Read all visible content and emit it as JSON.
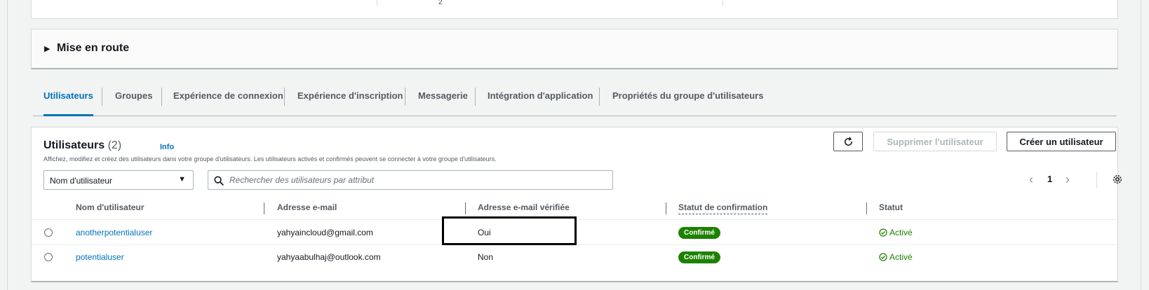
{
  "top_card": {
    "mark": "2"
  },
  "getting_started": {
    "title": "Mise en route"
  },
  "tabs": [
    {
      "label": "Utilisateurs",
      "active": true
    },
    {
      "label": "Groupes"
    },
    {
      "label": "Expérience de connexion"
    },
    {
      "label": "Expérience d'inscription"
    },
    {
      "label": "Messagerie"
    },
    {
      "label": "Intégration d'application"
    },
    {
      "label": "Propriétés du groupe d'utilisateurs"
    }
  ],
  "users_panel": {
    "title": "Utilisateurs",
    "count": "(2)",
    "info": "Info",
    "description": "Affichez, modifiez et créez des utilisateurs dans votre groupe d'utilisateurs. Les utilisateurs activés et confirmés peuvent se connecter à votre groupe d'utilisateurs.",
    "refresh_icon": "refresh-icon",
    "delete_label": "Supprimer l'utilisateur",
    "create_label": "Créer un utilisateur",
    "filter_select": "Nom d'utilisateur",
    "search_placeholder": "Rechercher des utilisateurs par attribut",
    "page_number": "1",
    "columns": [
      "Nom d'utilisateur",
      "Adresse e-mail",
      "Adresse e-mail vérifiée",
      "Statut de confirmation",
      "Statut"
    ],
    "rows": [
      {
        "username": "anotherpotentialuser",
        "email": "yahyaincloud@gmail.com",
        "verified": "Oui",
        "confirmation": "Confirmé",
        "status": "Activé"
      },
      {
        "username": "potentialuser",
        "email": "yahyaabulhaj@outlook.com",
        "verified": "Non",
        "confirmation": "Confirmé",
        "status": "Activé"
      }
    ]
  },
  "colors": {
    "link": "#0073bb",
    "success": "#1d8102",
    "border": "#aab7b8"
  }
}
